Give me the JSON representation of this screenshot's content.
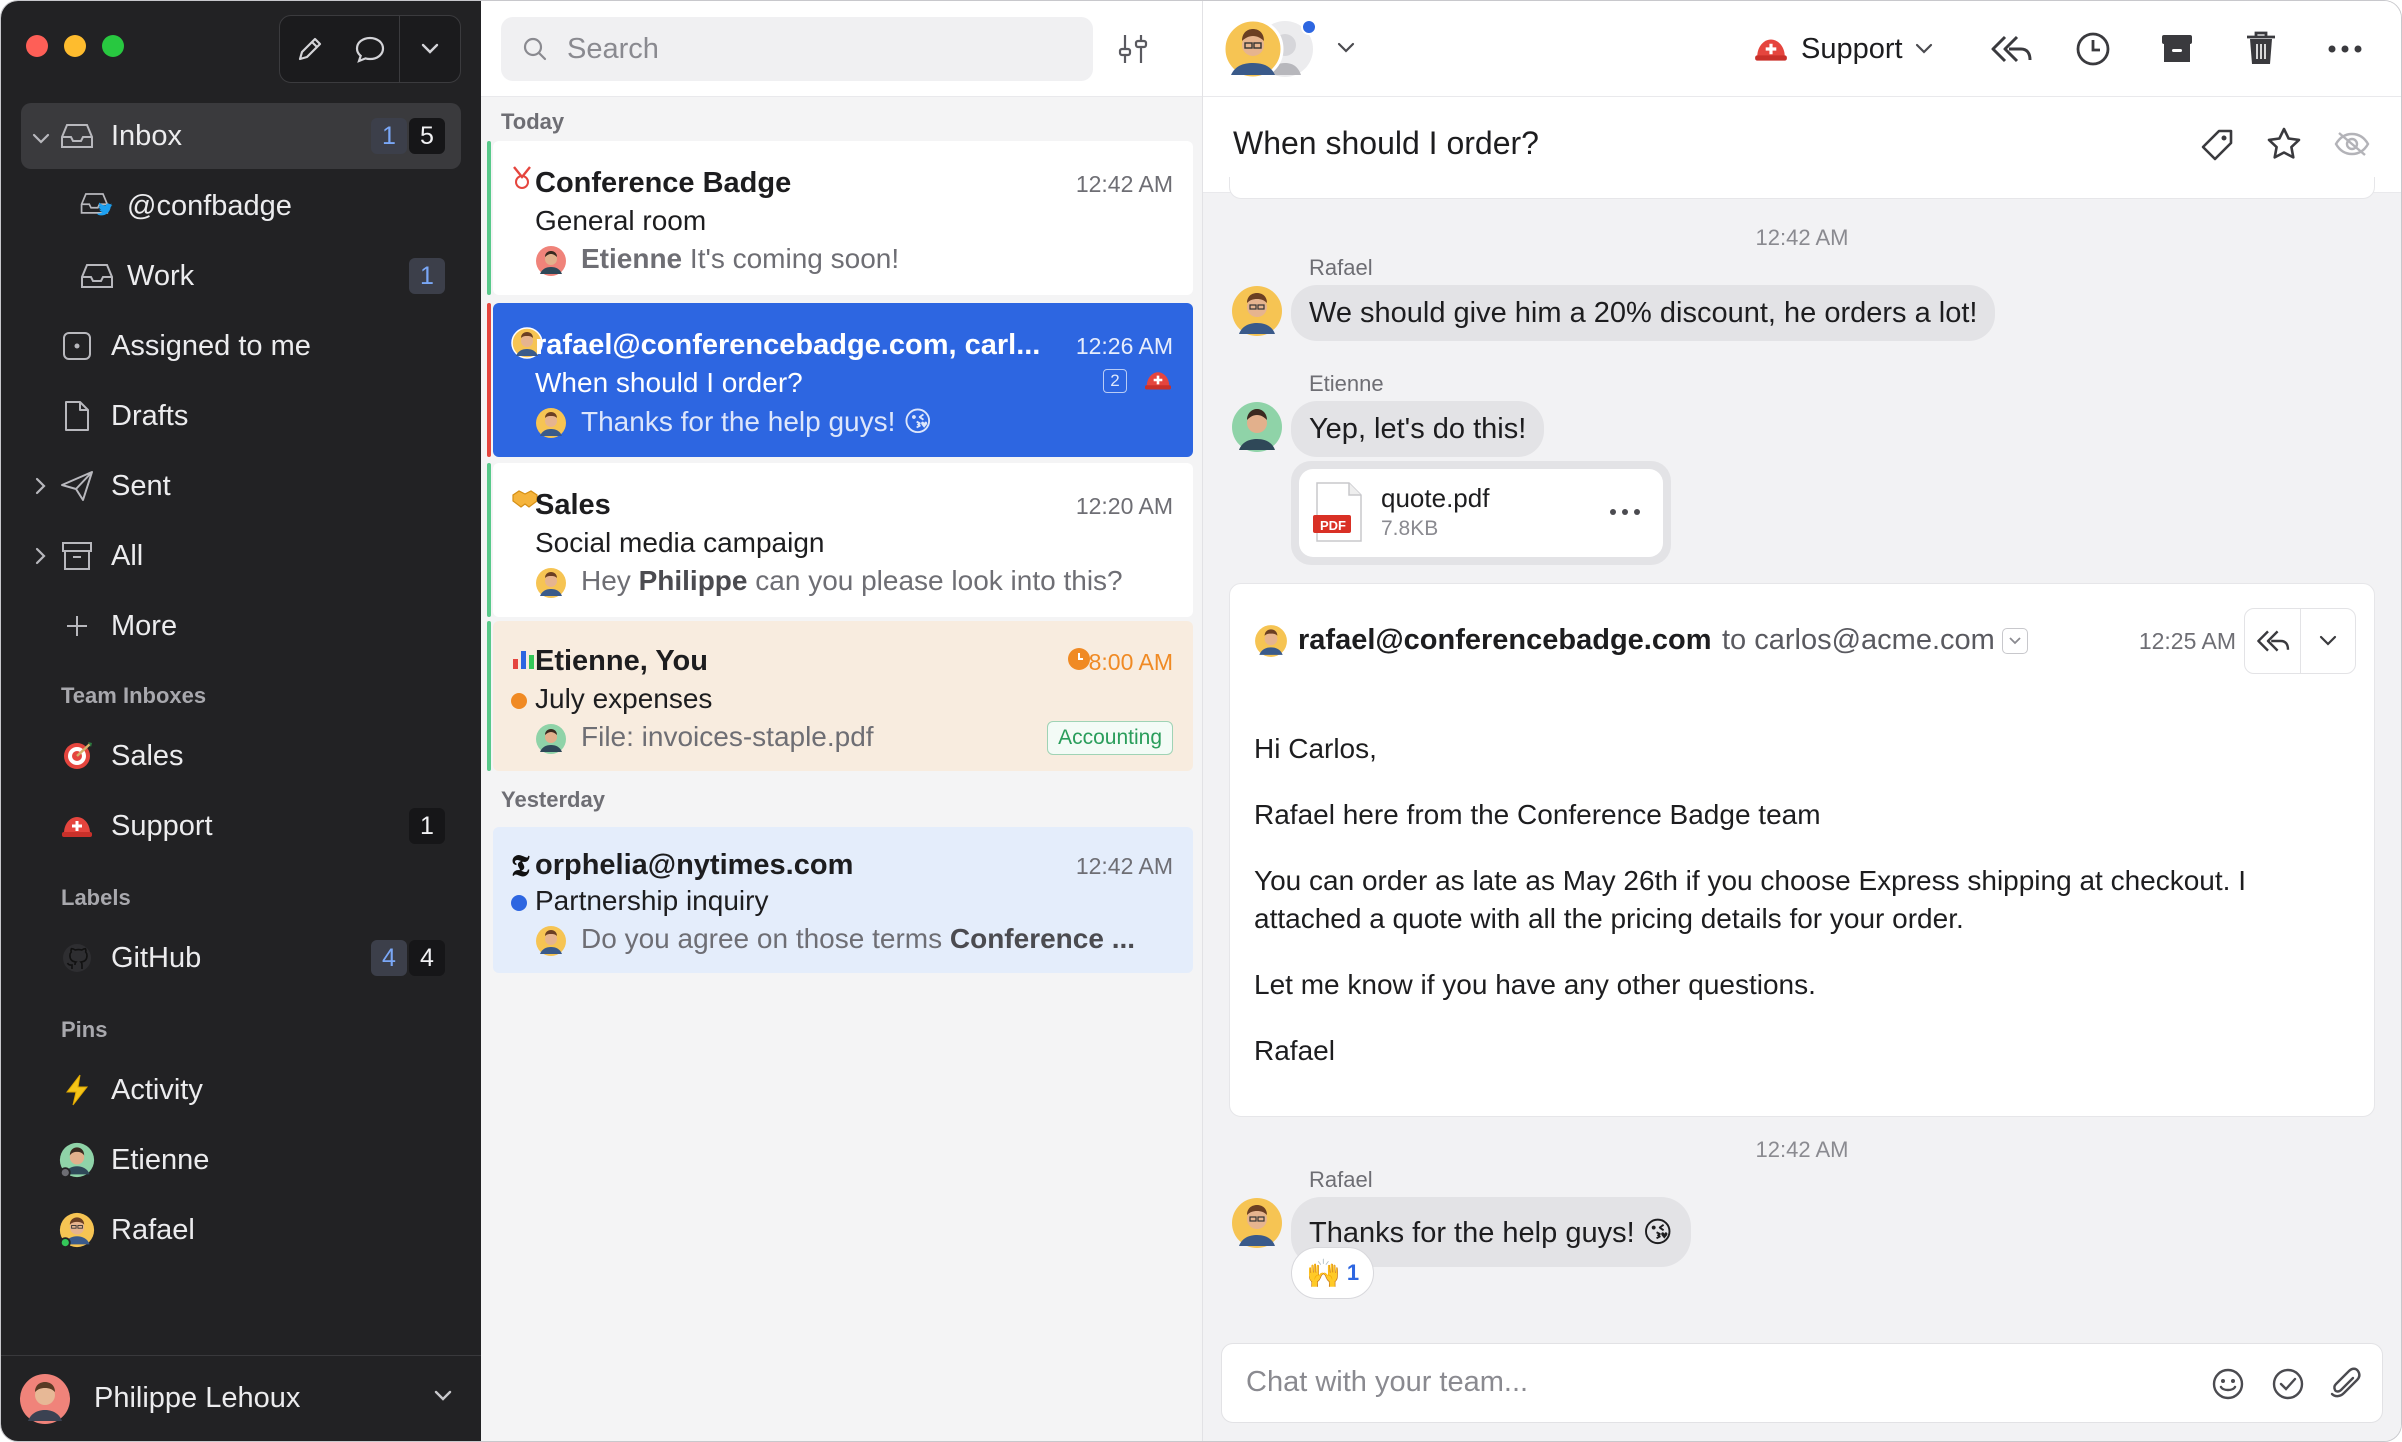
{
  "sidebar": {
    "items": [
      {
        "label": "Inbox",
        "badge_unread": "1",
        "badge_total": "5"
      },
      {
        "label": "@confbadge"
      },
      {
        "label": "Work",
        "badge_total": "1"
      },
      {
        "label": "Assigned to me"
      },
      {
        "label": "Drafts"
      },
      {
        "label": "Sent"
      },
      {
        "label": "All"
      },
      {
        "label": "More"
      }
    ],
    "team_inboxes_title": "Team Inboxes",
    "team_inboxes": [
      {
        "label": "Sales"
      },
      {
        "label": "Support",
        "badge_total": "1"
      }
    ],
    "labels_title": "Labels",
    "labels": [
      {
        "label": "GitHub",
        "badge_unread": "4",
        "badge_total": "4"
      }
    ],
    "pins_title": "Pins",
    "pins": [
      {
        "label": "Activity"
      },
      {
        "label": "Etienne"
      },
      {
        "label": "Rafael"
      }
    ],
    "user_name": "Philippe Lehoux"
  },
  "list": {
    "search_placeholder": "Search",
    "today_label": "Today",
    "yesterday_label": "Yesterday",
    "conversations": [
      {
        "title": "Conference Badge",
        "time": "12:42 AM",
        "subject": "General room",
        "preview_author": "Etienne",
        "preview": "It's coming soon!"
      },
      {
        "title": "rafael@conferencebadge.com, carl...",
        "time": "12:26 AM",
        "subject": "When should I order?",
        "preview": "Thanks for the help guys! 😘",
        "count": "2"
      },
      {
        "title": "Sales",
        "time": "12:20 AM",
        "subject": "Social media campaign",
        "preview_pre": "Hey ",
        "preview_bold": "Philippe",
        "preview_post": " can you please look into this?"
      },
      {
        "title": "Etienne, You",
        "time": "8:00 AM",
        "subject": "July expenses",
        "preview": "File: invoices-staple.pdf",
        "tag": "Accounting"
      },
      {
        "title": "orphelia@nytimes.com",
        "time": "12:42 AM",
        "subject": "Partnership inquiry",
        "preview_pre": "Do you agree on those terms ",
        "preview_bold": "Conference ..."
      }
    ]
  },
  "detail": {
    "inbox_selector": "Support",
    "subject": "When should I order?",
    "messages": {
      "ts1": "12:42 AM",
      "m1_author": "Rafael",
      "m1_text": "We should give him a 20% discount, he orders a lot!",
      "m2_author": "Etienne",
      "m2_text": "Yep, let's do this!",
      "attachment_name": "quote.pdf",
      "attachment_size": "7.8KB",
      "attachment_type": "PDF",
      "ts2": "12:42 AM",
      "m3_author": "Rafael",
      "m3_text": "Thanks for the help guys! 😘",
      "reaction_emoji": "🙌",
      "reaction_count": "1"
    },
    "email": {
      "from": "rafael@conferencebadge.com",
      "to_prefix": "to",
      "to": "carlos@acme.com",
      "time": "12:25 AM",
      "body": [
        "Hi Carlos,",
        "Rafael here from the Conference Badge team",
        "You can order as late as May 26th if you choose Express shipping at checkout. I attached a quote with all the pricing details for your order.",
        "Let me know if you have any other questions.",
        "Rafael"
      ]
    },
    "composer_placeholder": "Chat with your team..."
  },
  "colors": {
    "sidebar_bg": "#222224",
    "accent_blue": "#2d66e1",
    "tl_red": "#fe5f57",
    "tl_yellow": "#febc2e",
    "tl_green": "#28c840",
    "bar_green": "#58c98a",
    "bar_red": "#e5453e"
  }
}
